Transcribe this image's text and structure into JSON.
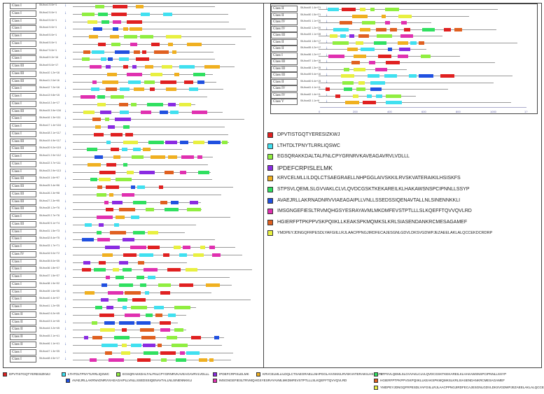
{
  "motifs": [
    {
      "id": "m1",
      "color": "#e02020",
      "seq": "DPVTISTGQTYERESIZKWJ"
    },
    {
      "id": "m2",
      "color": "#40e0f0",
      "seq": "LTHTDLTPNYTLRRLIQSWC"
    },
    {
      "id": "m3",
      "color": "#90ee40",
      "seq": "EGSQRAKKDALTALFNLCPYGRNRVKAVEAGAVRVLVDLLL"
    },
    {
      "id": "m4",
      "color": "#8a2be2",
      "seq": "IPDEFCRPISLELMK"
    },
    {
      "id": "m5",
      "color": "#f0b020",
      "seq": "KRVCELMLLILDQLCTSAEGRAELLNHPGGLAIVSKKILRVSKVATERAIKILHSISKFS"
    },
    {
      "id": "m6",
      "color": "#30e060",
      "seq": "STPSVLQEMLSLGVVAKLCLVLQVDCGSKTKEKAREILKLHAKAWSNSPCIPNNLLSSYP"
    },
    {
      "id": "m7",
      "color": "#2050e0",
      "seq": "AVAEJRLLAKRNADNRVVIAEAGAIPLLVNLLSSEDSSIQENAVTALLNLSINENNKKLI"
    },
    {
      "id": "m8",
      "color": "#e030b0",
      "seq": "IMSGNGEFIESLTRVMQHGSYESRAYAVMLMKDMFEVSTPTLLLSLKQEFFTQVVQVLRD"
    },
    {
      "id": "m9",
      "color": "#e06020",
      "seq": "HGIERFPTPKPPVSKPQIIKLLKEAKSPKMQMKSLKRLSIASENDANKRCMESAGAMEF"
    },
    {
      "id": "m10",
      "color": "#e8f040",
      "seq": "YMDPEYJDNGQFRPESDLYAFGIILLRJLAACPPNGJIRDFECAJESGNLGDVLDKSVGDWPJEZAEELAKLALQCCEKDCRDRP"
    }
  ],
  "left_rows": [
    {
      "cls": "Class I",
      "gene": "StUbox1",
      "val": "5.0e+1"
    },
    {
      "cls": "Class I",
      "gene": "StUbox2",
      "val": "5.0e+1"
    },
    {
      "cls": "Class I",
      "gene": "StUbox3",
      "val": "5.0e+1"
    },
    {
      "cls": "Class I",
      "gene": "StUbox4",
      "val": "5.0e+1"
    },
    {
      "cls": "Class I",
      "gene": "StUbox5",
      "val": "5.0e+1"
    },
    {
      "cls": "Class I",
      "gene": "StUbox6",
      "val": "5.0e+1"
    },
    {
      "cls": "Class I",
      "gene": "StUbox7",
      "val": "5.0e+1"
    },
    {
      "cls": "Class I",
      "gene": "StUbox8",
      "val": "9.2e+16"
    },
    {
      "cls": "Class III",
      "gene": "StUbox9",
      "val": "5.0e+17"
    },
    {
      "cls": "Class III",
      "gene": "StUbox10",
      "val": "1.2e+16"
    },
    {
      "cls": "Class III",
      "gene": "StUbox11",
      "val": "2.0e+16"
    },
    {
      "cls": "Class I",
      "gene": "StUbox12",
      "val": "7.2e+16"
    },
    {
      "cls": "Class I",
      "gene": "StUbox13",
      "val": "9.8e+15"
    },
    {
      "cls": "Class I",
      "gene": "StUbox14",
      "val": "2.4e+17"
    },
    {
      "cls": "Class III",
      "gene": "StUbox15",
      "val": "3.9e+134"
    },
    {
      "cls": "Class I",
      "gene": "StUbox16",
      "val": "1.3e+111"
    },
    {
      "cls": "Class I",
      "gene": "StUbox17",
      "val": "1.4e+116"
    },
    {
      "cls": "Class I",
      "gene": "StUbox18",
      "val": "2.1e+117"
    },
    {
      "cls": "Class III",
      "gene": "StUbox19",
      "val": "4.9e+117"
    },
    {
      "cls": "Class III",
      "gene": "StUbox20",
      "val": "9.2e+119"
    },
    {
      "cls": "Class I",
      "gene": "StUbox21",
      "val": "2.9e+112"
    },
    {
      "cls": "Class I",
      "gene": "StUbox22",
      "val": "3.7e+111"
    },
    {
      "cls": "Class I",
      "gene": "StUbox23",
      "val": "2.9e+113"
    },
    {
      "cls": "Class III",
      "gene": "StUbox24",
      "val": "1.6e+97"
    },
    {
      "cls": "Class III",
      "gene": "StUbox25",
      "val": "3.4e+96"
    },
    {
      "cls": "Class III",
      "gene": "StUbox26",
      "val": "2.3e+98"
    },
    {
      "cls": "Class III",
      "gene": "StUbox27",
      "val": "2.3e+95"
    },
    {
      "cls": "Class III",
      "gene": "StUbox28",
      "val": "1.2e+76"
    },
    {
      "cls": "Class I",
      "gene": "StUbox29",
      "val": "2.7e+76"
    },
    {
      "cls": "Class III",
      "gene": "StUbox30",
      "val": "5.1e+74"
    },
    {
      "cls": "Class I",
      "gene": "StUbox31",
      "val": "1.5e+73"
    },
    {
      "cls": "Class I",
      "gene": "StUbox32",
      "val": "8.4e+75"
    },
    {
      "cls": "Class I",
      "gene": "StUbox33",
      "val": "1.7e+71"
    },
    {
      "cls": "Class IV",
      "gene": "StUbox34",
      "val": "5.0e+72"
    },
    {
      "cls": "Class I",
      "gene": "StUbox35",
      "val": "8.0e+35"
    },
    {
      "cls": "Class I",
      "gene": "StUbox36",
      "val": "1.8e+37"
    },
    {
      "cls": "Class I",
      "gene": "StUbox37",
      "val": "1.5e+37"
    },
    {
      "cls": "Class I",
      "gene": "StUbox38",
      "val": "1.9e+32"
    },
    {
      "cls": "Class I",
      "gene": "StUbox39",
      "val": "1.6e+35"
    },
    {
      "cls": "Class I",
      "gene": "StUbox40",
      "val": "4.4e+37"
    },
    {
      "cls": "Class I",
      "gene": "StUbox41",
      "val": "1.2e+35"
    },
    {
      "cls": "Class II",
      "gene": "StUbox42",
      "val": "6.2e+45"
    },
    {
      "cls": "Class II",
      "gene": "StUbox43",
      "val": "5.1e+45"
    },
    {
      "cls": "Class II",
      "gene": "StUbox44",
      "val": "3.2e+45"
    },
    {
      "cls": "Class II",
      "gene": "StUbox45",
      "val": "2.1e+41"
    },
    {
      "cls": "Class II",
      "gene": "StUbox46",
      "val": "1.1e+41"
    },
    {
      "cls": "Class I",
      "gene": "StUbox47",
      "val": "1.3e+35"
    },
    {
      "cls": "Class I",
      "gene": "StUbox48",
      "val": "4.5e+17"
    }
  ],
  "right_rows": [
    {
      "cls": "Class II",
      "gene": "StUbox49",
      "val": "1.4e+21"
    },
    {
      "cls": "Class II",
      "gene": "StUbox50",
      "val": "1.5e+21"
    },
    {
      "cls": "Class IV",
      "gene": "StUbox51",
      "val": "1.1e+20"
    },
    {
      "cls": "Class IV",
      "gene": "StUbox52",
      "val": "1.2e+20"
    },
    {
      "cls": "Class III",
      "gene": "StUbox53",
      "val": "1.1e+28"
    },
    {
      "cls": "Class II",
      "gene": "StUbox54",
      "val": "1.8e+17"
    },
    {
      "cls": "Class II",
      "gene": "StUbox55",
      "val": "4.2e+17"
    },
    {
      "cls": "Class I",
      "gene": "StUbox56",
      "val": "1.2e+17"
    },
    {
      "cls": "Class III",
      "gene": "StUbox57",
      "val": "1.5e+16"
    },
    {
      "cls": "Class III",
      "gene": "StUbox58",
      "val": "1.3e+15"
    },
    {
      "cls": "Class III",
      "gene": "StUbox59",
      "val": "5.4e+16"
    },
    {
      "cls": "Class II",
      "gene": "StUbox60",
      "val": "6.4e+15"
    },
    {
      "cls": "Class IV",
      "gene": "StUbox61",
      "val": "4.1e+11"
    },
    {
      "cls": "Class IV",
      "gene": "StUbox62",
      "val": "1.4e+11"
    },
    {
      "cls": "Class V",
      "gene": "StUbox63",
      "val": "1.1e+6"
    }
  ],
  "axis_ticks": [
    "0",
    "200",
    "400",
    "600",
    "800",
    "1000",
    "1?"
  ]
}
